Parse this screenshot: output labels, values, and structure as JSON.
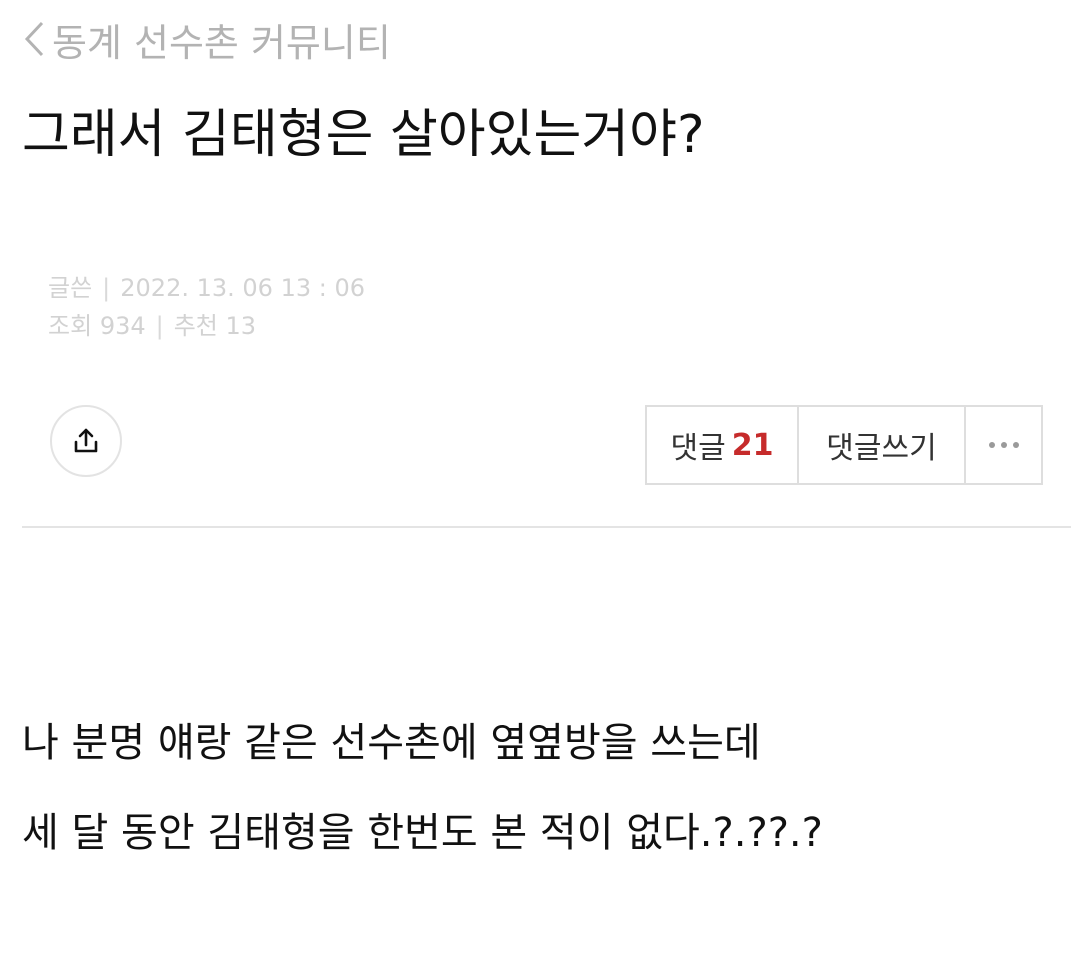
{
  "nav": {
    "back_label": "동계 선수촌 커뮤니티"
  },
  "post": {
    "title": "그래서 김태형은 살아있는거야?",
    "meta": {
      "author_label": "글쓴",
      "date": "2022. 13. 06 13 : 06",
      "views_label": "조회",
      "views": "934",
      "recommend_label": "추천",
      "recommend": "13"
    },
    "body": [
      "나 분명 얘랑 같은 선수촌에 옆옆방을 쓰는데",
      "세 달 동안 김태형을 한번도 본 적이 없다.?.??.?"
    ]
  },
  "actions": {
    "comments_label": "댓글",
    "comments_count": "21",
    "write_comment_label": "댓글쓰기"
  },
  "icons": {
    "back": "chevron-left-icon",
    "share": "share-icon",
    "more": "more-horizontal-icon"
  },
  "colors": {
    "accent_count": "#c62b2b",
    "muted_text": "#d2d2d2",
    "nav_text": "#b3b3b3",
    "border": "#dedede"
  }
}
